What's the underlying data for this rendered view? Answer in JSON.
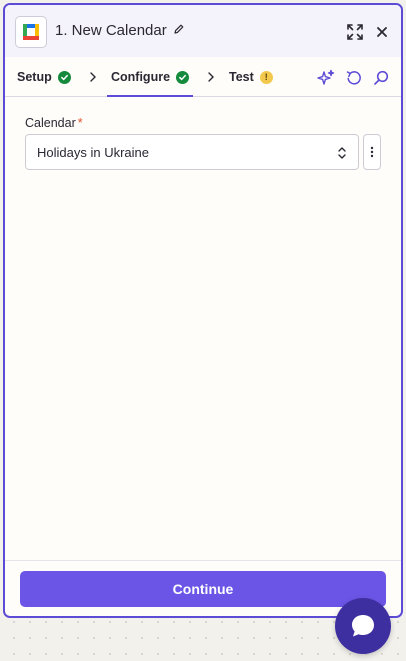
{
  "header": {
    "title": "1. New Calendar",
    "app_icon": "google-calendar-icon",
    "edit_icon": "pencil-icon",
    "expand_icon": "expand-icon",
    "close_icon": "close-icon"
  },
  "tabs": [
    {
      "label": "Setup",
      "status": "complete"
    },
    {
      "label": "Configure",
      "status": "complete",
      "active": true
    },
    {
      "label": "Test",
      "status": "warning",
      "badge": "!"
    }
  ],
  "tools": [
    "ai-sparkle-icon",
    "undo-icon",
    "search-icon"
  ],
  "form": {
    "calendar_label": "Calendar",
    "required_mark": "*",
    "calendar_value": "Holidays in Ukraine"
  },
  "footer": {
    "continue_label": "Continue"
  },
  "colors": {
    "accent": "#6b55e6",
    "border": "#5b4bd6",
    "success": "#158a3c",
    "warning": "#f2c94c",
    "fab": "#3d2fa0"
  }
}
